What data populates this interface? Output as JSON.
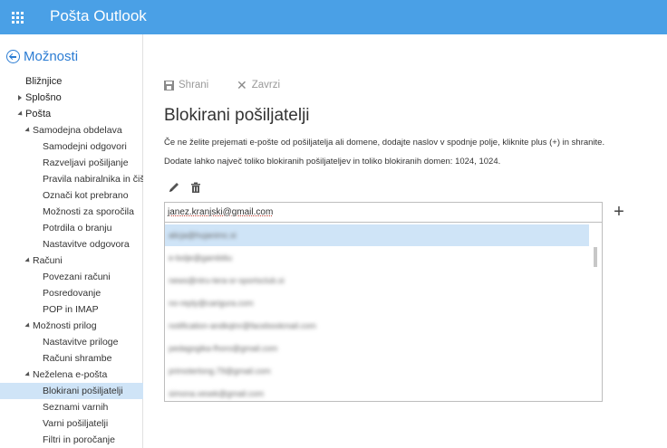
{
  "header": {
    "app_title": "Pošta Outlook",
    "waffle_icon": "app-launcher-icon"
  },
  "nav": {
    "back_label": "Možnosti",
    "items": [
      {
        "label": "Bližnjice",
        "level": 0,
        "expander": "none"
      },
      {
        "label": "Splošno",
        "level": 0,
        "expander": "collapsed"
      },
      {
        "label": "Pošta",
        "level": 0,
        "expander": "expanded"
      },
      {
        "label": "Samodejna obdelava",
        "level": 1,
        "expander": "expanded"
      },
      {
        "label": "Samodejni odgovori",
        "level": 2,
        "expander": "none"
      },
      {
        "label": "Razveljavi pošiljanje",
        "level": 2,
        "expander": "none"
      },
      {
        "label": "Pravila nabiralnika in čišče",
        "level": 2,
        "expander": "none"
      },
      {
        "label": "Označi kot prebrano",
        "level": 2,
        "expander": "none"
      },
      {
        "label": "Možnosti za sporočila",
        "level": 2,
        "expander": "none"
      },
      {
        "label": "Potrdila o branju",
        "level": 2,
        "expander": "none"
      },
      {
        "label": "Nastavitve odgovora",
        "level": 2,
        "expander": "none"
      },
      {
        "label": "Računi",
        "level": 1,
        "expander": "expanded"
      },
      {
        "label": "Povezani računi",
        "level": 2,
        "expander": "none"
      },
      {
        "label": "Posredovanje",
        "level": 2,
        "expander": "none"
      },
      {
        "label": "POP in IMAP",
        "level": 2,
        "expander": "none"
      },
      {
        "label": "Možnosti prilog",
        "level": 1,
        "expander": "expanded"
      },
      {
        "label": "Nastavitve priloge",
        "level": 2,
        "expander": "none"
      },
      {
        "label": "Računi shrambe",
        "level": 2,
        "expander": "none"
      },
      {
        "label": "Neželena e-pošta",
        "level": 1,
        "expander": "expanded"
      },
      {
        "label": "Blokirani pošiljatelji",
        "level": 2,
        "expander": "none",
        "selected": true
      },
      {
        "label": "Seznami varnih",
        "level": 2,
        "expander": "none"
      },
      {
        "label": "Varni pošiljatelji",
        "level": 2,
        "expander": "none"
      },
      {
        "label": "Filtri in poročanje",
        "level": 2,
        "expander": "none"
      }
    ]
  },
  "toolbar": {
    "save_label": "Shrani",
    "discard_label": "Zavrzi"
  },
  "main": {
    "title": "Blokirani pošiljatelji",
    "description_1": "Če ne želite prejemati e-pošte od pošiljatelja ali domene, dodajte naslov v spodnje polje, kliknite plus (+) in shranite.",
    "description_2": "Dodate lahko največ toliko blokiranih pošiljateljev in toliko blokiranih domen: 1024, 1024.",
    "edit_icon": "pencil-icon",
    "delete_icon": "trash-icon",
    "add_input_value": "janez.kranjski@gmail.com",
    "add_button_label": "+",
    "blocked_list": [
      "alicja@hujanimc.si",
      "e-bolje@gambitiu",
      "news@ntru-tera-sr-sportsclub.si",
      "no-reply@carigura.com",
      "notification-andkqtnr@facebookmail.com",
      "pedagogika-fhoro@gmail.com",
      "primoterlong.79@gmail.com",
      "simona.vesek@gmail.com"
    ],
    "selected_index": 0
  },
  "colors": {
    "topbar": "#4aa0e6",
    "accent": "#2b7cd3",
    "selection": "#cfe4f7"
  }
}
